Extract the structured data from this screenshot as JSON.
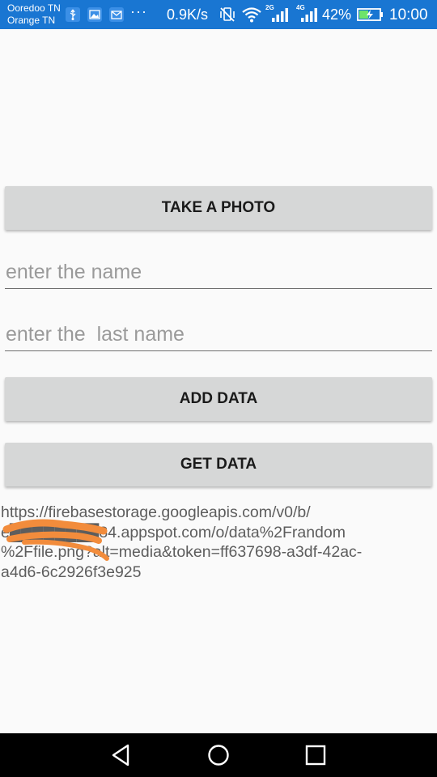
{
  "status_bar": {
    "carrier_1": "Ooredoo TN",
    "carrier_2": "Orange TN",
    "notification_icons": [
      "usb-icon",
      "image-icon",
      "mail-icon"
    ],
    "more": "···",
    "net_speed": "0.9K/s",
    "net_2g": "2G",
    "net_4g": "4G",
    "battery": "42%",
    "time": "10:00",
    "bg_color": "#1976d2"
  },
  "main": {
    "take_photo_label": "TAKE A PHOTO",
    "name_placeholder": "enter the name",
    "lastname_placeholder": "enter the  last name",
    "add_data_label": "ADD DATA",
    "get_data_label": "GET DATA",
    "url_text": "https://firebasestorage.googleapis.com/v0/b/\ne████████84.appspot.com/o/data%2Frandom\n%2Ffile.png?alt=media&token=ff637698-a3df-42ac-\na4d6-6c2926f3e925",
    "button_color": "#d6d7d7",
    "redaction_color": "#f28c3c"
  },
  "nav_bar": {
    "icons": [
      "back-icon",
      "home-icon",
      "recent-apps-icon"
    ]
  }
}
